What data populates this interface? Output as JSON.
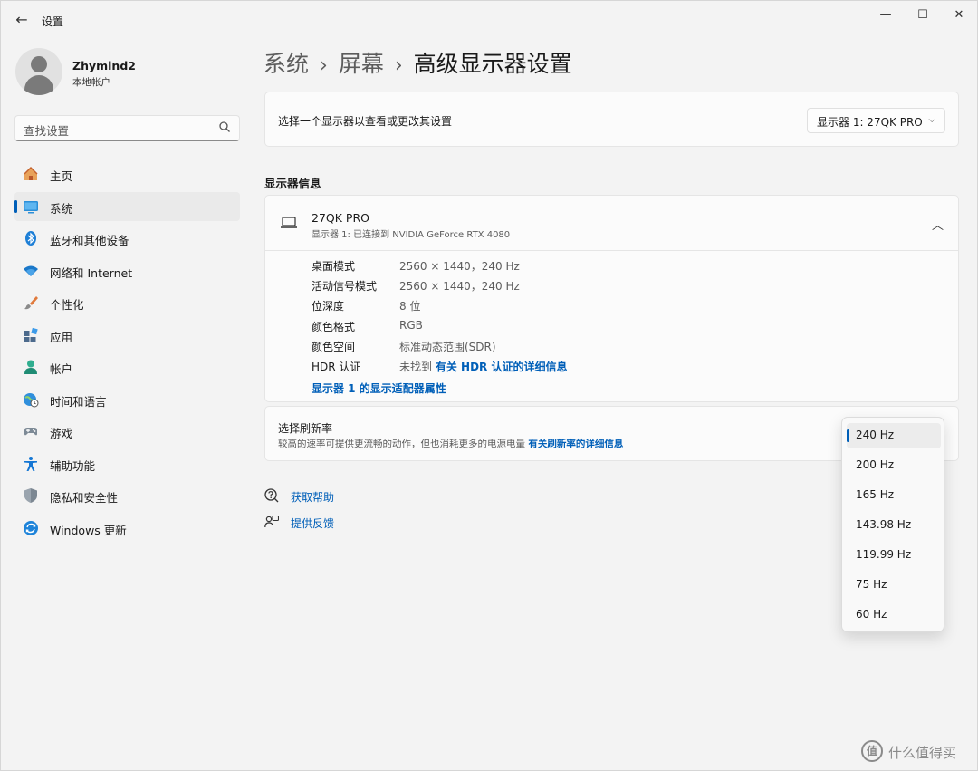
{
  "window": {
    "title": "设置",
    "back_glyph": "←",
    "minimize_glyph": "—",
    "maximize_glyph": "☐",
    "close_glyph": "✕"
  },
  "profile": {
    "name": "Zhymind2",
    "account_type": "本地帐户"
  },
  "search": {
    "placeholder": "查找设置",
    "icon": "search-icon"
  },
  "sidebar": {
    "items": [
      {
        "label": "主页",
        "icon": "home-icon",
        "active": false
      },
      {
        "label": "系统",
        "icon": "system-display-icon",
        "active": true
      },
      {
        "label": "蓝牙和其他设备",
        "icon": "bluetooth-icon",
        "active": false
      },
      {
        "label": "网络和 Internet",
        "icon": "wifi-icon",
        "active": false
      },
      {
        "label": "个性化",
        "icon": "brush-icon",
        "active": false
      },
      {
        "label": "应用",
        "icon": "apps-icon",
        "active": false
      },
      {
        "label": "帐户",
        "icon": "account-icon",
        "active": false
      },
      {
        "label": "时间和语言",
        "icon": "globe-clock-icon",
        "active": false
      },
      {
        "label": "游戏",
        "icon": "gamepad-icon",
        "active": false
      },
      {
        "label": "辅助功能",
        "icon": "accessibility-icon",
        "active": false
      },
      {
        "label": "隐私和安全性",
        "icon": "shield-icon",
        "active": false
      },
      {
        "label": "Windows 更新",
        "icon": "update-icon",
        "active": false
      }
    ]
  },
  "breadcrumb": {
    "part1": "系统",
    "part2": "屏幕",
    "current": "高级显示器设置",
    "separator": "›"
  },
  "display_selector": {
    "label": "选择一个显示器以查看或更改其设置",
    "selected": "显示器 1: 27QK PRO",
    "chevron": "⌵"
  },
  "display_info": {
    "section_title": "显示器信息",
    "monitor_name": "27QK PRO",
    "monitor_sub": "显示器 1: 已连接到 NVIDIA GeForce RTX 4080",
    "collapse_glyph": "︿",
    "rows": [
      {
        "key": "桌面模式",
        "value": "2560 × 1440，240 Hz"
      },
      {
        "key": "活动信号模式",
        "value": "2560 × 1440，240 Hz"
      },
      {
        "key": "位深度",
        "value": "8 位"
      },
      {
        "key": "颜色格式",
        "value": "RGB"
      },
      {
        "key": "颜色空间",
        "value": "标准动态范围(SDR)"
      },
      {
        "key": "HDR 认证",
        "value": "未找到",
        "link": "有关 HDR 认证的详细信息"
      }
    ],
    "adapter_link": "显示器 1 的显示适配器属性"
  },
  "refresh_rate": {
    "title": "选择刷新率",
    "description": "较高的速率可提供更流畅的动作，但也消耗更多的电源电量",
    "link": "有关刷新率的详细信息",
    "options": [
      "240 Hz",
      "200 Hz",
      "165 Hz",
      "143.98 Hz",
      "119.99 Hz",
      "75 Hz",
      "60 Hz"
    ],
    "selected": "240 Hz"
  },
  "help_links": {
    "get_help": "获取帮助",
    "feedback": "提供反馈"
  },
  "watermark": {
    "badge": "值",
    "text": "什么值得买"
  },
  "colors": {
    "accent": "#005fb8",
    "background": "#f3f3f3",
    "card": "#fbfbfb"
  }
}
